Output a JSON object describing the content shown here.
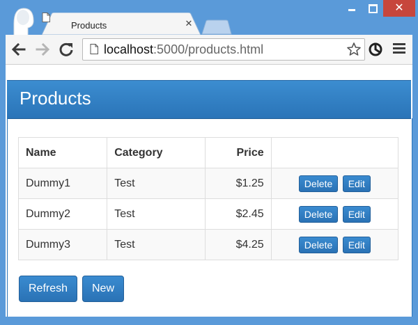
{
  "browser": {
    "tab": {
      "title": "Products"
    },
    "address_bar": {
      "url_host": "localhost",
      "url_rest": ":5000/products.html"
    }
  },
  "page": {
    "panel_title": "Products",
    "table": {
      "headers": {
        "name": "Name",
        "category": "Category",
        "price": "Price"
      },
      "rows": [
        {
          "name": "Dummy1",
          "category": "Test",
          "price": "$1.25",
          "delete_label": "Delete",
          "edit_label": "Edit"
        },
        {
          "name": "Dummy2",
          "category": "Test",
          "price": "$2.45",
          "delete_label": "Delete",
          "edit_label": "Edit"
        },
        {
          "name": "Dummy3",
          "category": "Test",
          "price": "$4.25",
          "delete_label": "Delete",
          "edit_label": "Edit"
        }
      ]
    },
    "buttons": {
      "refresh_label": "Refresh",
      "new_label": "New"
    }
  },
  "colors": {
    "frame": "#5a9ad9",
    "panel_heading": "#3c8dd0",
    "button_primary": "#2a72b5",
    "close_button": "#c7463c"
  },
  "icons": {
    "profile": "profile-icon",
    "tab_favicon": "document-icon",
    "tab_close": "close-icon",
    "back": "arrow-left-icon",
    "forward": "arrow-right-icon",
    "reload": "reload-icon",
    "page_info": "page-icon",
    "bookmark": "star-icon",
    "extension": "extension-icon",
    "menu": "hamburger-menu-icon"
  }
}
